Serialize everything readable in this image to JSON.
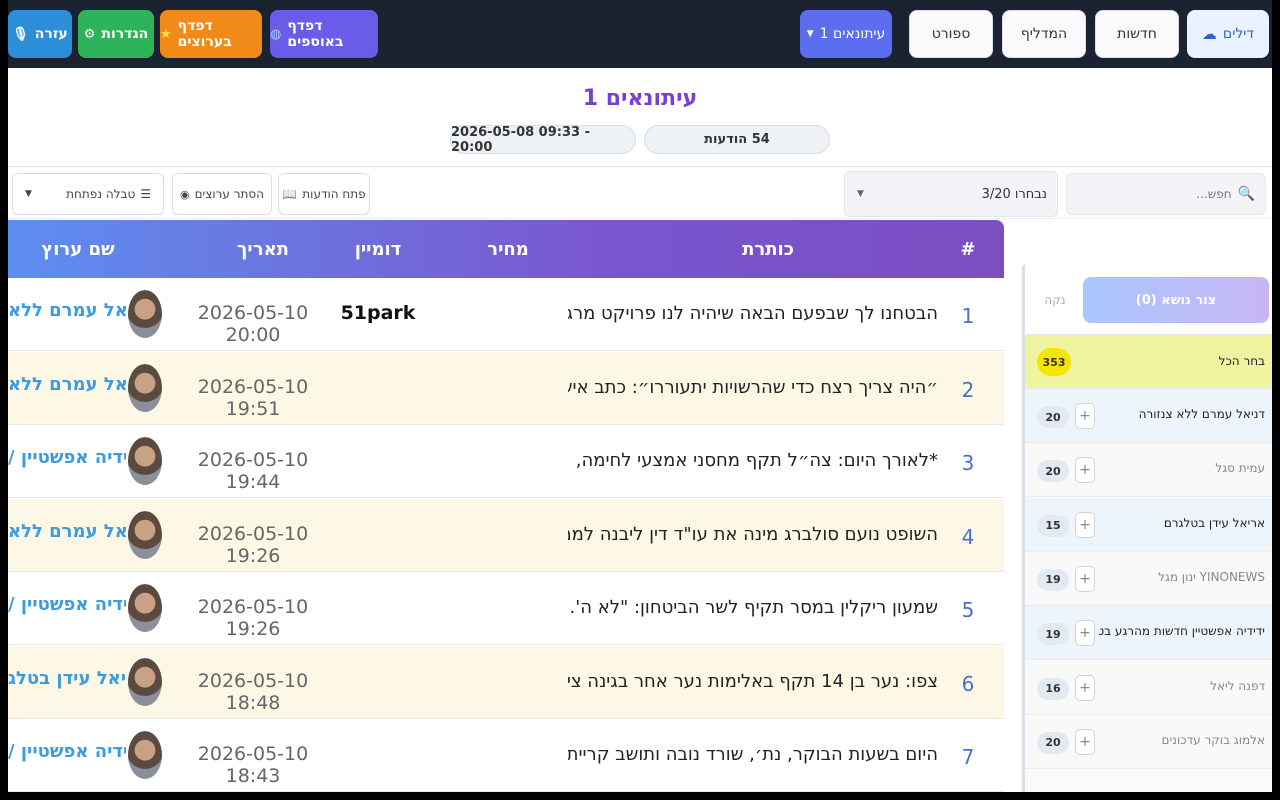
{
  "nav": {
    "help": "עזרה",
    "settings": "הגדרות",
    "browse_channels": "דפדף בערוצים",
    "browse_collections": "דפדף באוספים",
    "journalists_dropdown": "עיתונאים 1",
    "sport": "ספורט",
    "hamadlif": "המדליף",
    "news": "חדשות",
    "deals": "דילים"
  },
  "header": {
    "title": "עיתונאים 1",
    "date_range": "2026-05-08 09:33 - 20:00",
    "message_count": "54 הודעות"
  },
  "toolbar": {
    "search_placeholder": "חפש...",
    "selected": "נבחרו 3/20",
    "open_messages": "פתח הודעות",
    "hide_channels": "הסתר ערוצים",
    "view_mode": "טבלה נפתחת"
  },
  "table": {
    "headers": {
      "num": "#",
      "title": "כותרת",
      "price": "מחיר",
      "domain": "דומיין",
      "date": "תאריך",
      "channel": "שם ערוץ"
    },
    "rows": [
      {
        "num": "1",
        "title": "הבטחנו לך שבפעם הבאה שיהיה לנו פרויקט מרגש...",
        "video": false,
        "domain": "51park",
        "date": "2026-05-10 20:00",
        "channel": "דניאל עמרם ללא"
      },
      {
        "num": "2",
        "title": "״היה צריך רצח כדי שהרשויות יתעוררו״: כתב אישו...",
        "video": false,
        "domain": "",
        "date": "2026-05-10 19:51",
        "channel": "דניאל עמרם ללא"
      },
      {
        "num": "3",
        "title": "*לאורך היום: צה״ל תקף מחסני אמצעי לחימה, ...",
        "video": true,
        "domain": "",
        "date": "2026-05-10 19:44",
        "channel": "ידידיה אפשטיין /"
      },
      {
        "num": "4",
        "title": "השופט נועם סולברג מינה את עו\"ד דין ליבנה לממל...",
        "video": false,
        "domain": "",
        "date": "2026-05-10 19:26",
        "channel": "דניאל עמרם ללא"
      },
      {
        "num": "5",
        "title": "שמעון ריקלין במסר תקיף לשר הביטחון: \"לא ה'...",
        "video": true,
        "domain": "",
        "date": "2026-05-10 19:26",
        "channel": "ידידיה אפשטיין /"
      },
      {
        "num": "6",
        "title": "צפו: נער בן 14 תקף באלימות נער אחר בגינה צי...",
        "video": true,
        "domain": "",
        "date": "2026-05-10 18:48",
        "channel": "אריאל עידן בטלג"
      },
      {
        "num": "7",
        "title": "היום בשעות הבוקר, נת׳, שורד נובה ותושב קריית...",
        "video": false,
        "domain": "",
        "date": "2026-05-10 18:43",
        "channel": "ידידיה אפשטיין /"
      }
    ]
  },
  "sidebar": {
    "create_topic": "צור נושא (0)",
    "clear": "נקה",
    "select_all": {
      "label": "בחר הכל",
      "count": "353"
    },
    "channels": [
      {
        "name": "דניאל עמרם ללא צנזורה",
        "count": "20",
        "selected": true
      },
      {
        "name": "עמית סגל",
        "count": "20",
        "selected": false
      },
      {
        "name": "אריאל עידן בטלגרם",
        "count": "15",
        "selected": true
      },
      {
        "name": "YINONEWS ינון מגל",
        "count": "19",
        "selected": false
      },
      {
        "name": "ידידיה אפשטיין חדשות מהרגע בט...",
        "count": "19",
        "selected": true
      },
      {
        "name": "דפנה ליאל",
        "count": "16",
        "selected": false
      },
      {
        "name": "אלמוג בוקר עדכונים",
        "count": "20",
        "selected": false
      }
    ]
  },
  "colors": {
    "nav_bg": "#1b2332",
    "help_btn": "#2d8ed8",
    "settings_btn": "#2fb35a",
    "channels_btn": "#f08b1a",
    "collections_btn": "#6a5be8",
    "journalists_btn": "#5b6ef0",
    "title_purple": "#7b3fd0",
    "row_alt": "#fdf8e6",
    "channel_link": "#3d9be0"
  }
}
